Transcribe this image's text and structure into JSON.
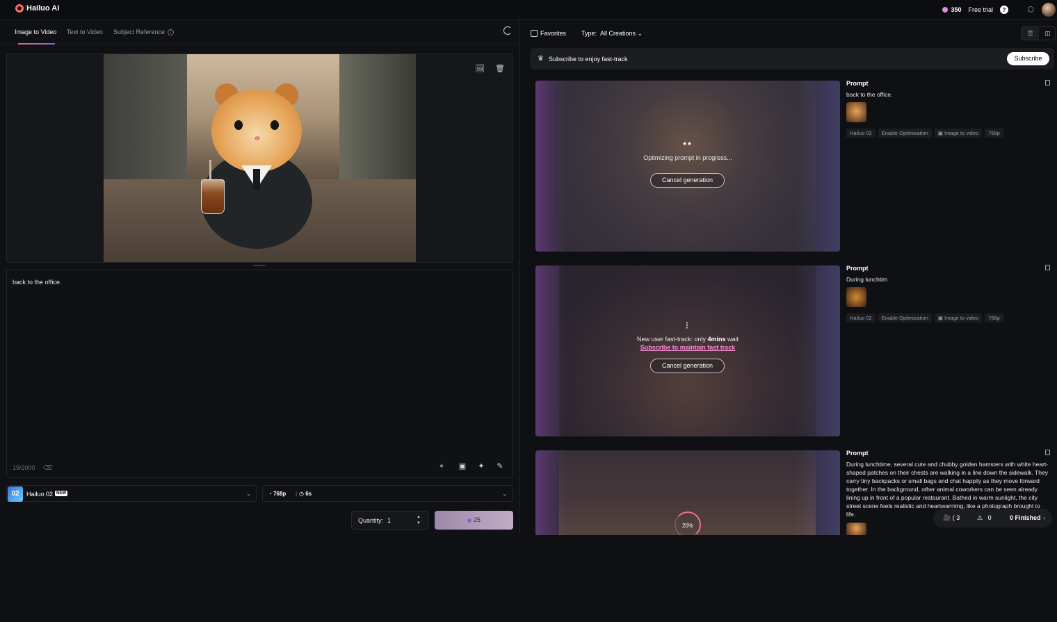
{
  "topbar": {
    "logo_text": "Hailuo AI",
    "credits": "350",
    "free_trial": "Free trial",
    "help": "?"
  },
  "left": {
    "tabs": [
      "Image to Video",
      "Text to Video",
      "Subject Reference"
    ],
    "prompt_text": "back to the office.",
    "char_count": "19/2000",
    "model": {
      "thumb_text": "02",
      "name": "Hailuo 02",
      "badge": "NEW"
    },
    "settings": {
      "resolution": "768p",
      "duration": "6s"
    },
    "quantity": {
      "label": "Quantity:",
      "value": "1"
    },
    "generate": {
      "cost": "25"
    }
  },
  "right": {
    "favorites_label": "Favorites",
    "type_label": "Type:",
    "type_value": "All Creations",
    "subscribe_banner": {
      "text": "Subscribe to enjoy fast-track",
      "button": "Subscribe"
    },
    "cards": [
      {
        "status": "Optimizing prompt in progress...",
        "cancel": "Cancel generation",
        "prompt_title": "Prompt",
        "prompt": "back to the office.",
        "tags": [
          "Hailuo 02",
          "Enable Optimization",
          "Image to video",
          "768p"
        ]
      },
      {
        "status_prefix": "New user fast-track: only ",
        "status_bold": "4mins",
        "status_suffix": " wait",
        "link": "Subscribe to maintain fast track",
        "cancel": "Cancel generation",
        "prompt_title": "Prompt",
        "prompt": "During lunchtim",
        "tags": [
          "Hailuo 02",
          "Enable Optimization",
          "Image to video",
          "768p"
        ]
      },
      {
        "progress": "20%",
        "progress_value": 0.2,
        "prompt_title": "Prompt",
        "prompt": "During lunchtime, several cute and chubby golden hamsters with white heart-shaped patches on their chests are walking in a line down the sidewalk. They carry tiny backpacks or small bags and chat happily as they move forward together. In the background, other animal coworkers can be seen already lining up in front of a popular restaurant. Bathed in warm sunlight, the city street scene feels realistic and heartwarming, like a photograph brought to life."
      }
    ],
    "status_pill": {
      "queued": "3",
      "failed": "0",
      "finished": "0 Finished"
    }
  },
  "icons": {
    "refresh": "refresh-icon",
    "upload_image": "image-upload-icon",
    "delete": "trash-icon",
    "copy": "copy-icon"
  },
  "colors": {
    "accent_pink": "#ff5a8c",
    "accent_purple": "#8a5cff",
    "link_pink": "#ff8ad8"
  }
}
